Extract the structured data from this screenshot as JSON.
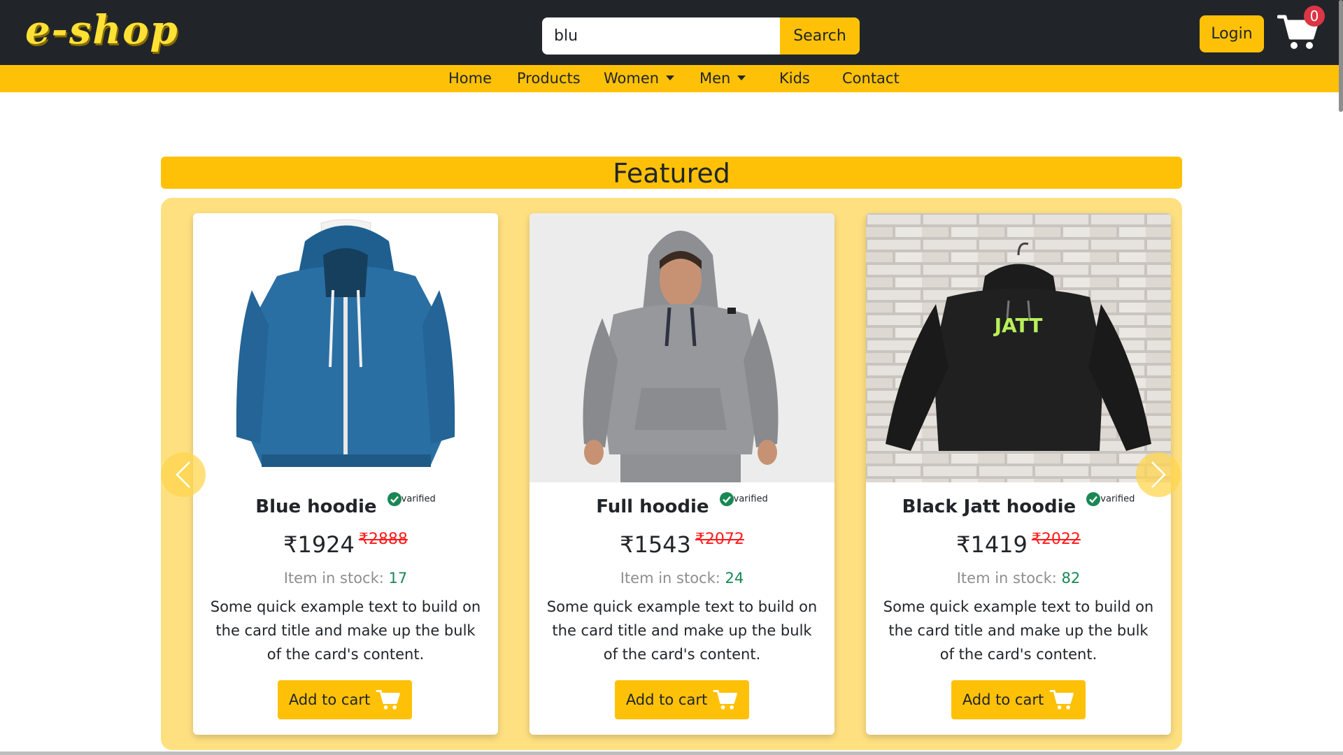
{
  "header": {
    "logo_text": "e-shop",
    "search": {
      "value": "blu",
      "button_label": "Search"
    },
    "login_label": "Login",
    "cart_count": "0"
  },
  "nav": {
    "items": [
      {
        "label": "Home"
      },
      {
        "label": "Products"
      },
      {
        "label": "Women",
        "dropdown": true
      },
      {
        "label": "Men",
        "dropdown": true
      },
      {
        "label": "Kids"
      },
      {
        "label": "Contact"
      }
    ]
  },
  "featured": {
    "heading": "Featured",
    "products": [
      {
        "title": "Blue hoodie",
        "verified_label": "varified",
        "price": "₹1924",
        "old_price": "₹2888",
        "stock_label": "Item in stock:",
        "stock": "17",
        "description": "Some quick example text to build on the card title and make up the bulk of the card's content.",
        "button_label": "Add to cart"
      },
      {
        "title": "Full hoodie",
        "verified_label": "varified",
        "price": "₹1543",
        "old_price": "₹2072",
        "stock_label": "Item in stock:",
        "stock": "24",
        "description": "Some quick example text to build on the card title and make up the bulk of the card's content.",
        "button_label": "Add to cart"
      },
      {
        "title": "Black Jatt hoodie",
        "verified_label": "varified",
        "price": "₹1419",
        "old_price": "₹2022",
        "stock_label": "Item in stock:",
        "stock": "82",
        "description": "Some quick example text to build on the card title and make up the bulk of the card's content.",
        "button_label": "Add to cart",
        "image_text": "JATT"
      }
    ]
  },
  "colors": {
    "accent": "#ffc107",
    "dark": "#212529",
    "carousel_bg": "#ffe081",
    "old_price": "#ff1a1a",
    "in_stock": "#198754",
    "badge": "#dc3545"
  },
  "icons": [
    "cart-icon",
    "verified-check-icon",
    "chevron-left-icon",
    "chevron-right-icon",
    "caret-down-icon"
  ]
}
